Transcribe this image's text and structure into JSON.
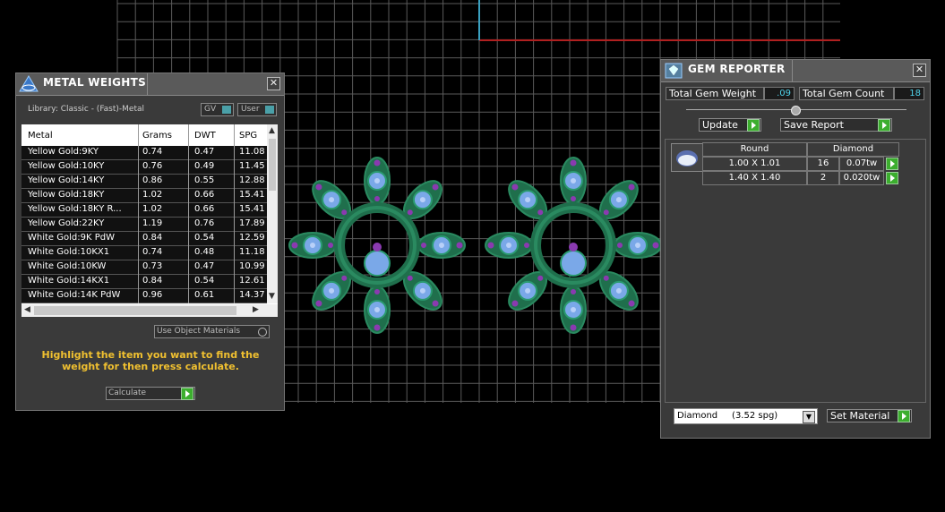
{
  "metal_weights": {
    "title": "METAL WEIGHTS",
    "library": "Library: Classic - (Fast)-Metal",
    "gv_label": "GV",
    "user_label": "User",
    "columns": [
      "Metal",
      "Grams",
      "DWT",
      "SPG"
    ],
    "rows": [
      [
        "Yellow Gold:9KY",
        "0.74",
        "0.47",
        "11.08"
      ],
      [
        "Yellow Gold:10KY",
        "0.76",
        "0.49",
        "11.45"
      ],
      [
        "Yellow Gold:14KY",
        "0.86",
        "0.55",
        "12.88"
      ],
      [
        "Yellow Gold:18KY",
        "1.02",
        "0.66",
        "15.41"
      ],
      [
        "Yellow Gold:18KY R...",
        "1.02",
        "0.66",
        "15.41"
      ],
      [
        "Yellow Gold:22KY",
        "1.19",
        "0.76",
        "17.89"
      ],
      [
        "White Gold:9K PdW",
        "0.84",
        "0.54",
        "12.59"
      ],
      [
        "White Gold:10KX1",
        "0.74",
        "0.48",
        "11.18"
      ],
      [
        "White Gold:10KW",
        "0.73",
        "0.47",
        "10.99"
      ],
      [
        "White Gold:14KX1",
        "0.84",
        "0.54",
        "12.61"
      ],
      [
        "White Gold:14K PdW",
        "0.96",
        "0.61",
        "14.37"
      ]
    ],
    "use_object_materials": "Use Object Materials",
    "hint": "Highlight the item you want to find the weight for then press calculate.",
    "calculate_label": "Calculate"
  },
  "gem_reporter": {
    "title": "GEM REPORTER",
    "total_gem_weight_label": "Total Gem Weight",
    "total_gem_weight": ".09",
    "total_gem_count_label": "Total Gem Count",
    "total_gem_count": "18",
    "update_label": "Update",
    "save_report_label": "Save Report",
    "shape_header": "Round",
    "material_header": "Diamond",
    "rows": [
      {
        "size": "1.00 X 1.01",
        "count": "16",
        "weight": "0.07tw"
      },
      {
        "size": "1.40 X 1.40",
        "count": "2",
        "weight": "0.020tw"
      }
    ],
    "material_select": "Diamond     (3.52 spg)",
    "set_material_label": "Set Material"
  },
  "colors": {
    "grid_line": "#5a5a5a",
    "axis_red": "#b02020",
    "axis_cyan": "#3aa0c0",
    "ring_green": "#2a8a60",
    "gem_blue": "#7aa8e8",
    "prong_purple": "#8a3ab0",
    "hint_text": "#f0c030",
    "value_cyan": "#4fd2ea",
    "go_green": "#3cae2e"
  }
}
